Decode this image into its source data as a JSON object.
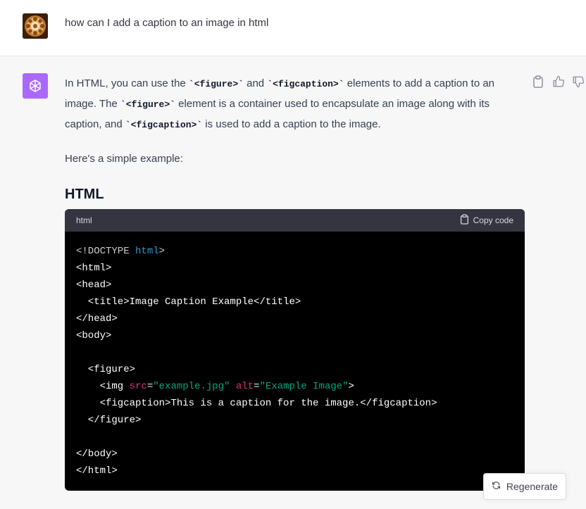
{
  "user_message": {
    "text": "how can I add a caption to an image in html"
  },
  "assistant_message": {
    "para1": [
      {
        "t": "text",
        "v": "In HTML, you can use the "
      },
      {
        "t": "code",
        "v": "`<figure>`"
      },
      {
        "t": "text",
        "v": " and "
      },
      {
        "t": "code",
        "v": "`<figcaption>`"
      },
      {
        "t": "text",
        "v": " elements to add a caption to an image. The "
      },
      {
        "t": "code",
        "v": "`<figure>`"
      },
      {
        "t": "text",
        "v": " element is a container used to encapsulate an image along with its caption, and "
      },
      {
        "t": "code",
        "v": "`<figcaption>`"
      },
      {
        "t": "text",
        "v": " is used to add a caption to the image."
      }
    ],
    "para2": "Here's a simple example:",
    "heading": "HTML"
  },
  "code_block": {
    "language": "html",
    "copy_label": "Copy code",
    "lines": [
      [
        {
          "c": "gray",
          "v": "<!DOCTYPE "
        },
        {
          "c": "blue",
          "v": "html"
        },
        {
          "c": "gray",
          "v": ">"
        }
      ],
      [
        {
          "c": "",
          "v": "<html>"
        }
      ],
      [
        {
          "c": "",
          "v": "<head>"
        }
      ],
      [
        {
          "c": "",
          "v": "  <title>Image Caption Example</title>"
        }
      ],
      [
        {
          "c": "",
          "v": "</head>"
        }
      ],
      [
        {
          "c": "",
          "v": "<body>"
        }
      ],
      [
        {
          "c": "",
          "v": ""
        }
      ],
      [
        {
          "c": "",
          "v": "  <figure>"
        }
      ],
      [
        {
          "c": "",
          "v": "    <img "
        },
        {
          "c": "red",
          "v": "src"
        },
        {
          "c": "",
          "v": "="
        },
        {
          "c": "green",
          "v": "\"example.jpg\""
        },
        {
          "c": "",
          "v": " "
        },
        {
          "c": "red",
          "v": "alt"
        },
        {
          "c": "",
          "v": "="
        },
        {
          "c": "green",
          "v": "\"Example Image\""
        },
        {
          "c": "",
          "v": ">"
        }
      ],
      [
        {
          "c": "",
          "v": "    <figcaption>This is a caption for the image.</figcaption>"
        }
      ],
      [
        {
          "c": "",
          "v": "  </figure>"
        }
      ],
      [
        {
          "c": "",
          "v": ""
        }
      ],
      [
        {
          "c": "",
          "v": "</body>"
        }
      ],
      [
        {
          "c": "",
          "v": "</html>"
        }
      ]
    ]
  },
  "regenerate_label": "Regenerate",
  "icons": {
    "user_avatar": "mandala-avatar",
    "assistant_avatar": "openai-logo-icon",
    "copy": "clipboard-icon",
    "thumbs_up": "thumbs-up-icon",
    "thumbs_down": "thumbs-down-icon",
    "regenerate": "refresh-icon"
  },
  "colors": {
    "assistant_avatar_bg": "#ab68ff",
    "code_bg": "#000000",
    "code_header_bg": "#343541",
    "syntax_blue": "#2e95d3",
    "syntax_red": "#df3079",
    "syntax_green": "#00a67d"
  }
}
